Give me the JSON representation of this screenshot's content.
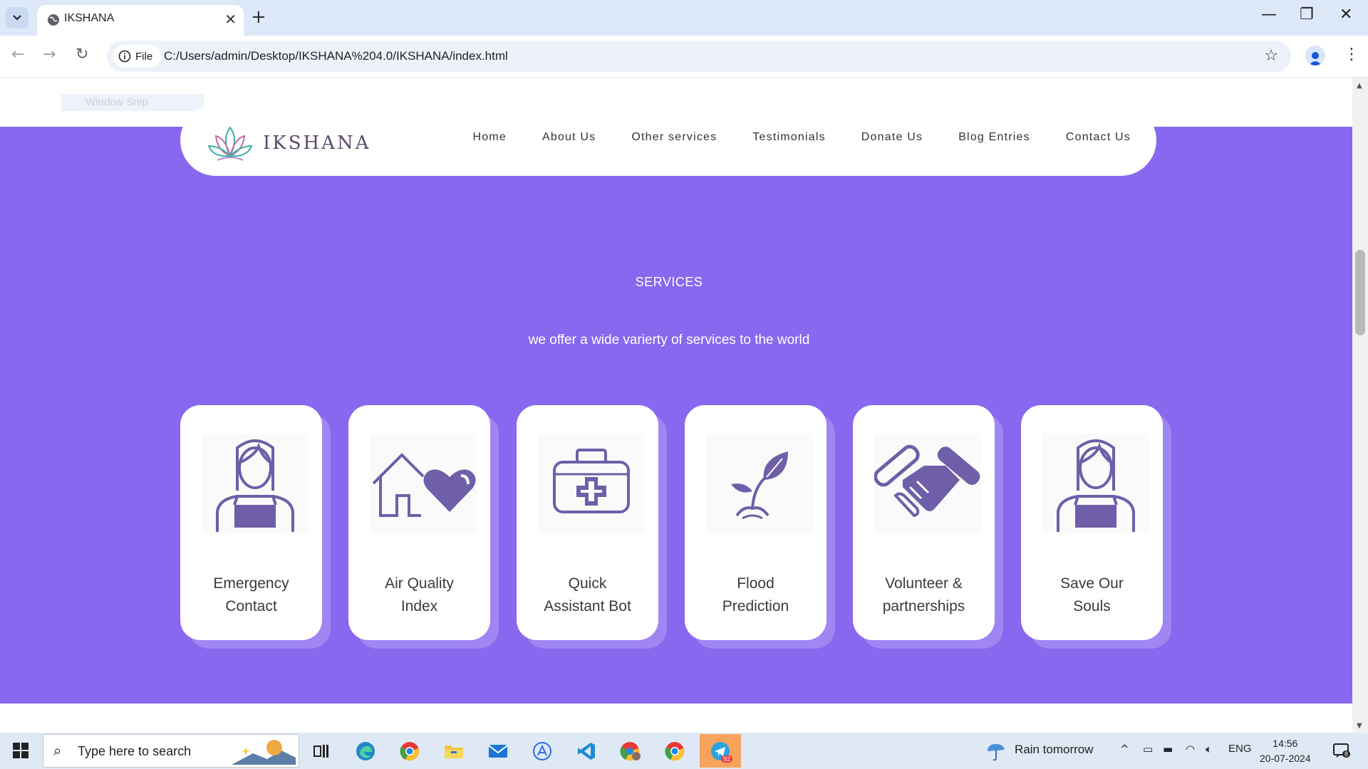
{
  "browser": {
    "tab_title": "IKSHANA",
    "tab_close": "✕",
    "new_tab": "+",
    "chip_label": "File",
    "url": "C:/Users/admin/Desktop/IKSHANA%204.0/IKSHANA/index.html"
  },
  "overlay": {
    "snip_label": "Window Snip"
  },
  "site": {
    "logo_text": "IKSHANA",
    "nav": [
      "Home",
      "About Us",
      "Other services",
      "Testimonials",
      "Donate Us",
      "Blog Entries",
      "Contact Us"
    ],
    "services_title": "SERVICES",
    "services_subtitle": "we offer a wide varierty of services to the world",
    "cards": [
      {
        "line1": "Emergency",
        "line2": "Contact",
        "icon": "woman-icon"
      },
      {
        "line1": "Air Quality",
        "line2": "Index",
        "icon": "house-heart-icon"
      },
      {
        "line1": "Quick",
        "line2": "Assistant Bot",
        "icon": "first-aid-kit-icon"
      },
      {
        "line1": "Flood",
        "line2": "Prediction",
        "icon": "sprout-icon"
      },
      {
        "line1": "Volunteer &",
        "line2": "partnerships",
        "icon": "handshake-icon"
      },
      {
        "line1": "Save Our",
        "line2": "Souls",
        "icon": "woman-icon"
      }
    ]
  },
  "taskbar": {
    "search_placeholder": "Type here to search",
    "weather": "Rain tomorrow",
    "lang": "ENG",
    "time": "14:56",
    "date": "20-07-2024",
    "telegram_badge": "92",
    "notification_count": "8"
  },
  "colors": {
    "accent": "#8768ee",
    "icon": "#6e5fa8"
  }
}
